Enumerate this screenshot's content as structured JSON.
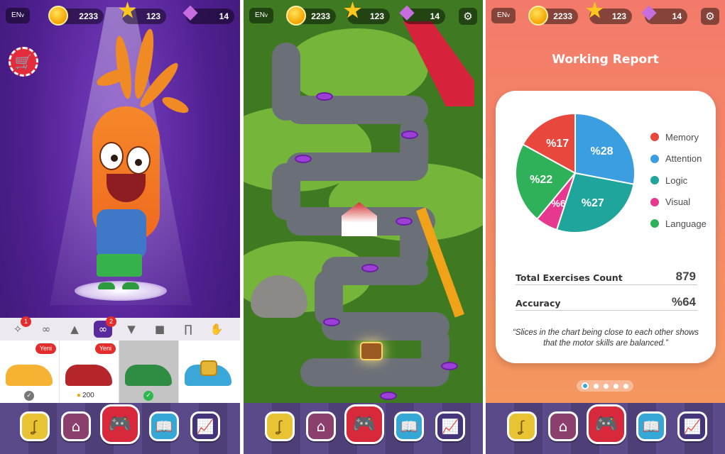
{
  "topbar": {
    "lang": "EN",
    "lang_arrow": "v",
    "coins": "2233",
    "stars": "123",
    "gems": "14"
  },
  "icons": {
    "coin": "coin-icon",
    "star": "star-icon",
    "gem": "gem-icon",
    "settings": "gear-icon",
    "cart": "shopping-cart-icon"
  },
  "shop": {
    "category_badges": [
      "1",
      "2"
    ],
    "items": [
      {
        "tag": "Yeni",
        "status": "owned"
      },
      {
        "tag": "Yeni",
        "price": "200"
      },
      {
        "tag": "",
        "status": "equipped"
      },
      {
        "tag": "",
        "status": "locked"
      }
    ]
  },
  "report": {
    "title": "Working Report",
    "chart_data": {
      "type": "pie",
      "slices": [
        {
          "name": "Attention",
          "value": 28,
          "label": "%28",
          "color": "#3b9ee0"
        },
        {
          "name": "Logic",
          "value": 27,
          "label": "%27",
          "color": "#1fa59c"
        },
        {
          "name": "Visual",
          "value": 6,
          "label": "%6",
          "color": "#e6388f"
        },
        {
          "name": "Language",
          "value": 22,
          "label": "%22",
          "color": "#2fb159"
        },
        {
          "name": "Memory",
          "value": 17,
          "label": "%17",
          "color": "#e7473c"
        }
      ],
      "legend": [
        "Memory",
        "Attention",
        "Logic",
        "Visual",
        "Language"
      ],
      "legend_colors": [
        "#e7473c",
        "#3b9ee0",
        "#1fa59c",
        "#e6388f",
        "#2fb159"
      ],
      "legend_position": "right"
    },
    "total_label": "Total Exercises Count",
    "total_value": "879",
    "accuracy_label": "Accuracy",
    "accuracy_value": "%64",
    "note": "“Slices in the chart being close to each other shows that the motor skills are balanced.”"
  },
  "colors": {
    "nav_yellow": "#e8c334",
    "nav_purple": "#8a3f6c",
    "nav_red": "#d8283b",
    "nav_blue": "#35a8d6",
    "nav_violet": "#44347a"
  }
}
